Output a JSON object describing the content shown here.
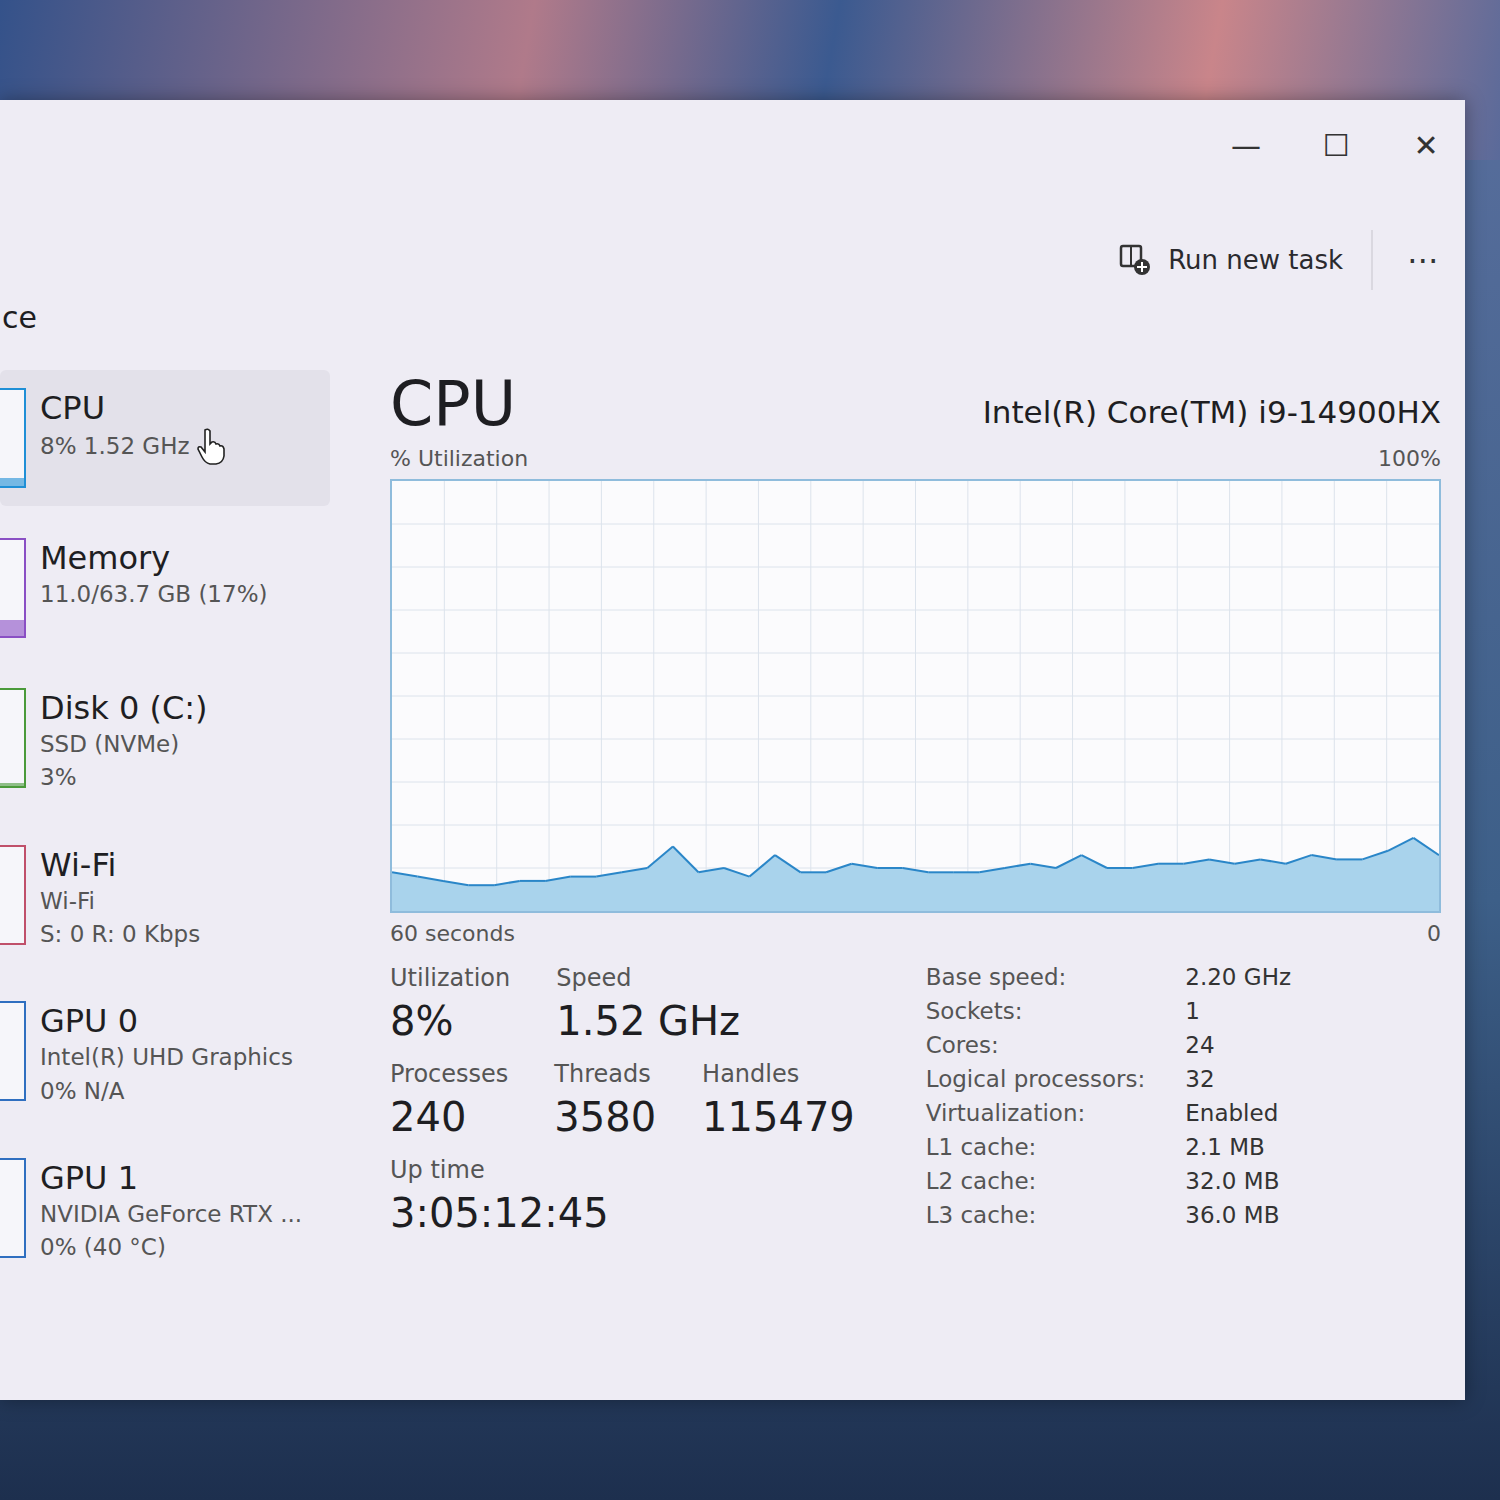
{
  "window": {
    "controls": [
      "—",
      "☐",
      "✕"
    ]
  },
  "toolbar": {
    "run_new_task": "Run new task",
    "more": "⋯"
  },
  "page": {
    "title": "ce"
  },
  "sidebar": {
    "items": [
      {
        "title": "CPU",
        "lines": [
          "8%  1.52 GHz"
        ],
        "selected": true,
        "color": "#1f8fd6",
        "level": 0.08
      },
      {
        "title": "Memory",
        "lines": [
          "11.0/63.7 GB (17%)"
        ],
        "selected": false,
        "color": "#8a4fc4",
        "level": 0.17
      },
      {
        "title": "Disk 0 (C:)",
        "lines": [
          "SSD (NVMe)",
          "3%"
        ],
        "selected": false,
        "color": "#4a9a3a",
        "level": 0.03
      },
      {
        "title": "Wi-Fi",
        "lines": [
          "Wi-Fi",
          "S: 0  R: 0 Kbps"
        ],
        "selected": false,
        "color": "#c0506a",
        "level": 0
      },
      {
        "title": "GPU 0",
        "lines": [
          "Intel(R) UHD Graphics",
          "0%  N/A"
        ],
        "selected": false,
        "color": "#2f6fc0",
        "level": 0
      },
      {
        "title": "GPU 1",
        "lines": [
          "NVIDIA GeForce RTX ...",
          "0%  (40 °C)"
        ],
        "selected": false,
        "color": "#2f6fc0",
        "level": 0
      }
    ]
  },
  "cpu": {
    "title": "CPU",
    "model": "Intel(R) Core(TM) i9-14900HX"
  },
  "chart": {
    "y_label": "% Utilization",
    "max_label": "100%",
    "min_label": "0",
    "x_label": "60 seconds",
    "max": 100,
    "series": [
      9,
      8,
      7,
      6,
      6,
      7,
      7,
      8,
      8,
      9,
      10,
      15,
      9,
      10,
      8,
      13,
      9,
      9,
      11,
      10,
      10,
      9,
      9,
      9,
      10,
      11,
      10,
      13,
      10,
      10,
      11,
      11,
      12,
      11,
      12,
      11,
      13,
      12,
      12,
      14,
      17,
      13
    ]
  },
  "stats": {
    "rows": [
      [
        {
          "label": "Utilization",
          "value": "8%"
        },
        {
          "label": "Speed",
          "value": "1.52 GHz"
        }
      ],
      [
        {
          "label": "Processes",
          "value": "240"
        },
        {
          "label": "Threads",
          "value": "3580"
        },
        {
          "label": "Handles",
          "value": "115479"
        }
      ],
      [
        {
          "label": "Up time",
          "value": "3:05:12:45"
        }
      ]
    ]
  },
  "details": [
    {
      "label": "Base speed:",
      "value": "2.20 GHz"
    },
    {
      "label": "Sockets:",
      "value": "1"
    },
    {
      "label": "Cores:",
      "value": "24"
    },
    {
      "label": "Logical processors:",
      "value": "32"
    },
    {
      "label": "Virtualization:",
      "value": "Enabled"
    },
    {
      "label": "L1 cache:",
      "value": "2.1 MB"
    },
    {
      "label": "L2 cache:",
      "value": "32.0 MB"
    },
    {
      "label": "L3 cache:",
      "value": "36.0 MB"
    }
  ]
}
